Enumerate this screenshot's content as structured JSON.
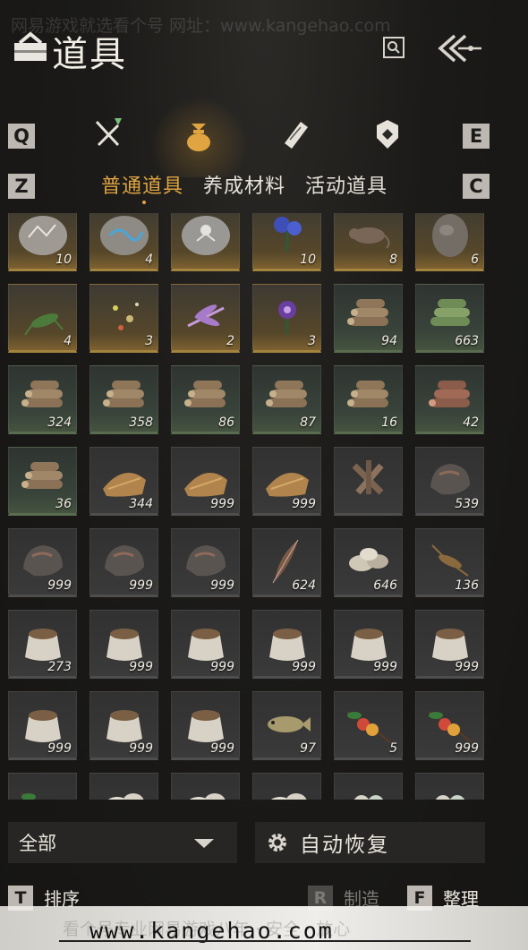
{
  "watermark": {
    "top_text": "网易游戏就选看个号   网址：www.kangehao.com",
    "bottom_text": "看个号专业网易游戏八年 · 安全 · 放心",
    "url": "www.kangehao.com"
  },
  "header": {
    "title": "道具",
    "title_icon": "bag-icon",
    "search_icon": "search-icon",
    "back_icon": "double-chevron-left-icon"
  },
  "tabs": {
    "left_key": "Q",
    "right_key": "E",
    "items": [
      {
        "icon": "crossed-swords-icon",
        "active": false
      },
      {
        "icon": "pouch-icon",
        "active": true
      },
      {
        "icon": "scroll-icon",
        "active": false
      },
      {
        "icon": "badge-icon",
        "active": false
      }
    ]
  },
  "subtabs": {
    "left_key": "Z",
    "right_key": "C",
    "items": [
      "普通道具",
      "养成材料",
      "活动道具"
    ],
    "active_index": 0
  },
  "grid": {
    "items": [
      {
        "icon": "carved-stone-tablet-icon",
        "qty": "10",
        "rarity": "gold"
      },
      {
        "icon": "blue-ore-tablet-icon",
        "qty": "4",
        "rarity": "gold"
      },
      {
        "icon": "spirit-stone-tablet-icon",
        "qty": "",
        "rarity": "gold"
      },
      {
        "icon": "blue-flower-icon",
        "qty": "10",
        "rarity": "gold"
      },
      {
        "icon": "rat-icon",
        "qty": "8",
        "rarity": "gold"
      },
      {
        "icon": "rock-icon",
        "qty": "6",
        "rarity": "gold"
      },
      {
        "icon": "cricket-icon",
        "qty": "4",
        "rarity": "gold"
      },
      {
        "icon": "fireflies-icon",
        "qty": "3",
        "rarity": "gold"
      },
      {
        "icon": "dragonfly-icon",
        "qty": "2",
        "rarity": "gold"
      },
      {
        "icon": "purple-flower-icon",
        "qty": "3",
        "rarity": "gold"
      },
      {
        "icon": "wood-logs-icon",
        "qty": "94",
        "rarity": "green"
      },
      {
        "icon": "bamboo-logs-icon",
        "qty": "663",
        "rarity": "green"
      },
      {
        "icon": "wood-logs-icon",
        "qty": "324",
        "rarity": "green"
      },
      {
        "icon": "wood-logs-icon",
        "qty": "358",
        "rarity": "green"
      },
      {
        "icon": "wood-logs-icon",
        "qty": "86",
        "rarity": "green"
      },
      {
        "icon": "wood-logs-icon",
        "qty": "87",
        "rarity": "green"
      },
      {
        "icon": "wood-logs-icon",
        "qty": "16",
        "rarity": "green"
      },
      {
        "icon": "red-wood-logs-icon",
        "qty": "42",
        "rarity": "green"
      },
      {
        "icon": "wood-logs-icon",
        "qty": "36",
        "rarity": "green"
      },
      {
        "icon": "straw-bundle-icon",
        "qty": "344",
        "rarity": "gray"
      },
      {
        "icon": "straw-bundle-icon",
        "qty": "999",
        "rarity": "gray"
      },
      {
        "icon": "straw-bundle-icon",
        "qty": "999",
        "rarity": "gray"
      },
      {
        "icon": "firewood-icon",
        "qty": "",
        "rarity": "gray"
      },
      {
        "icon": "ore-rock-icon",
        "qty": "539",
        "rarity": "gray"
      },
      {
        "icon": "ore-rock-icon",
        "qty": "999",
        "rarity": "gray"
      },
      {
        "icon": "ore-rock-icon",
        "qty": "999",
        "rarity": "gray"
      },
      {
        "icon": "ore-rock-icon",
        "qty": "999",
        "rarity": "gray"
      },
      {
        "icon": "feather-icon",
        "qty": "624",
        "rarity": "gray"
      },
      {
        "icon": "shells-icon",
        "qty": "646",
        "rarity": "gray"
      },
      {
        "icon": "insect-icon",
        "qty": "136",
        "rarity": "gray"
      },
      {
        "icon": "grain-sack-icon",
        "qty": "273",
        "rarity": "gray"
      },
      {
        "icon": "grain-sack-icon",
        "qty": "999",
        "rarity": "gray"
      },
      {
        "icon": "grain-sack-icon",
        "qty": "999",
        "rarity": "gray"
      },
      {
        "icon": "grain-sack-icon",
        "qty": "999",
        "rarity": "gray"
      },
      {
        "icon": "grain-sack-icon",
        "qty": "999",
        "rarity": "gray"
      },
      {
        "icon": "grain-sack-icon",
        "qty": "999",
        "rarity": "gray"
      },
      {
        "icon": "grain-sack-icon",
        "qty": "999",
        "rarity": "gray"
      },
      {
        "icon": "grain-sack-icon",
        "qty": "999",
        "rarity": "gray"
      },
      {
        "icon": "grain-sack-icon",
        "qty": "999",
        "rarity": "gray"
      },
      {
        "icon": "fish-icon",
        "qty": "97",
        "rarity": "gray"
      },
      {
        "icon": "fruit-branch-icon",
        "qty": "5",
        "rarity": "gray"
      },
      {
        "icon": "fruit-branch-icon",
        "qty": "999",
        "rarity": "gray"
      },
      {
        "icon": "fruit-branch-icon",
        "qty": "",
        "rarity": "gray"
      },
      {
        "icon": "bones-icon",
        "qty": "",
        "rarity": "gray"
      },
      {
        "icon": "bones-icon",
        "qty": "",
        "rarity": "gray"
      },
      {
        "icon": "bones-icon",
        "qty": "",
        "rarity": "gray"
      },
      {
        "icon": "eggs-icon",
        "qty": "",
        "rarity": "gray"
      },
      {
        "icon": "eggs-icon",
        "qty": "",
        "rarity": "gray"
      }
    ]
  },
  "filter": {
    "value": "全部",
    "icon": "caret-down-icon"
  },
  "auto_restore": {
    "label": "自动恢复",
    "icon": "gear-icon"
  },
  "footer": {
    "sort": {
      "key": "T",
      "label": "排序"
    },
    "craft": {
      "key": "R",
      "label": "制造"
    },
    "organize": {
      "key": "F",
      "label": "整理"
    }
  }
}
